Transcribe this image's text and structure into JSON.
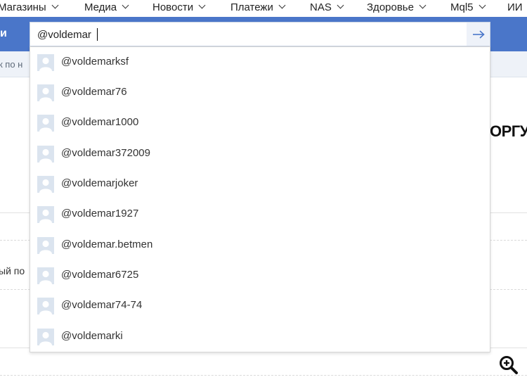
{
  "nav": {
    "items": [
      {
        "label": "Магазины"
      },
      {
        "label": "Медиа"
      },
      {
        "label": "Новости"
      },
      {
        "label": "Платежи"
      },
      {
        "label": "NAS"
      },
      {
        "label": "Здоровье"
      },
      {
        "label": "Mql5"
      },
      {
        "label": "ИИ"
      }
    ]
  },
  "header": {
    "left_label": "и"
  },
  "search": {
    "value": "@voldemar",
    "submit_icon": "arrow-right-icon"
  },
  "subbar": {
    "text": "к по н"
  },
  "page": {
    "heading_fragment": "ОРГУ",
    "side_text": "ый по"
  },
  "suggestions": [
    {
      "username": "@voldemarksf"
    },
    {
      "username": "@voldemar76"
    },
    {
      "username": "@voldemar1000"
    },
    {
      "username": "@voldemar372009"
    },
    {
      "username": "@voldemarjoker"
    },
    {
      "username": "@voldemar1927"
    },
    {
      "username": "@voldemar.betmen"
    },
    {
      "username": "@voldemar6725"
    },
    {
      "username": "@voldemar74-74"
    },
    {
      "username": "@voldemarki"
    }
  ],
  "colors": {
    "header_blue": "#4a76c9",
    "subbar_bg": "#eef2f8",
    "avatar_bg": "#dbe4ef",
    "submit_arrow": "#4a76c9"
  },
  "icons": {
    "avatar": "default-avatar-icon",
    "zoom": "zoom-in-icon",
    "chevron": "chevron-down-icon"
  }
}
